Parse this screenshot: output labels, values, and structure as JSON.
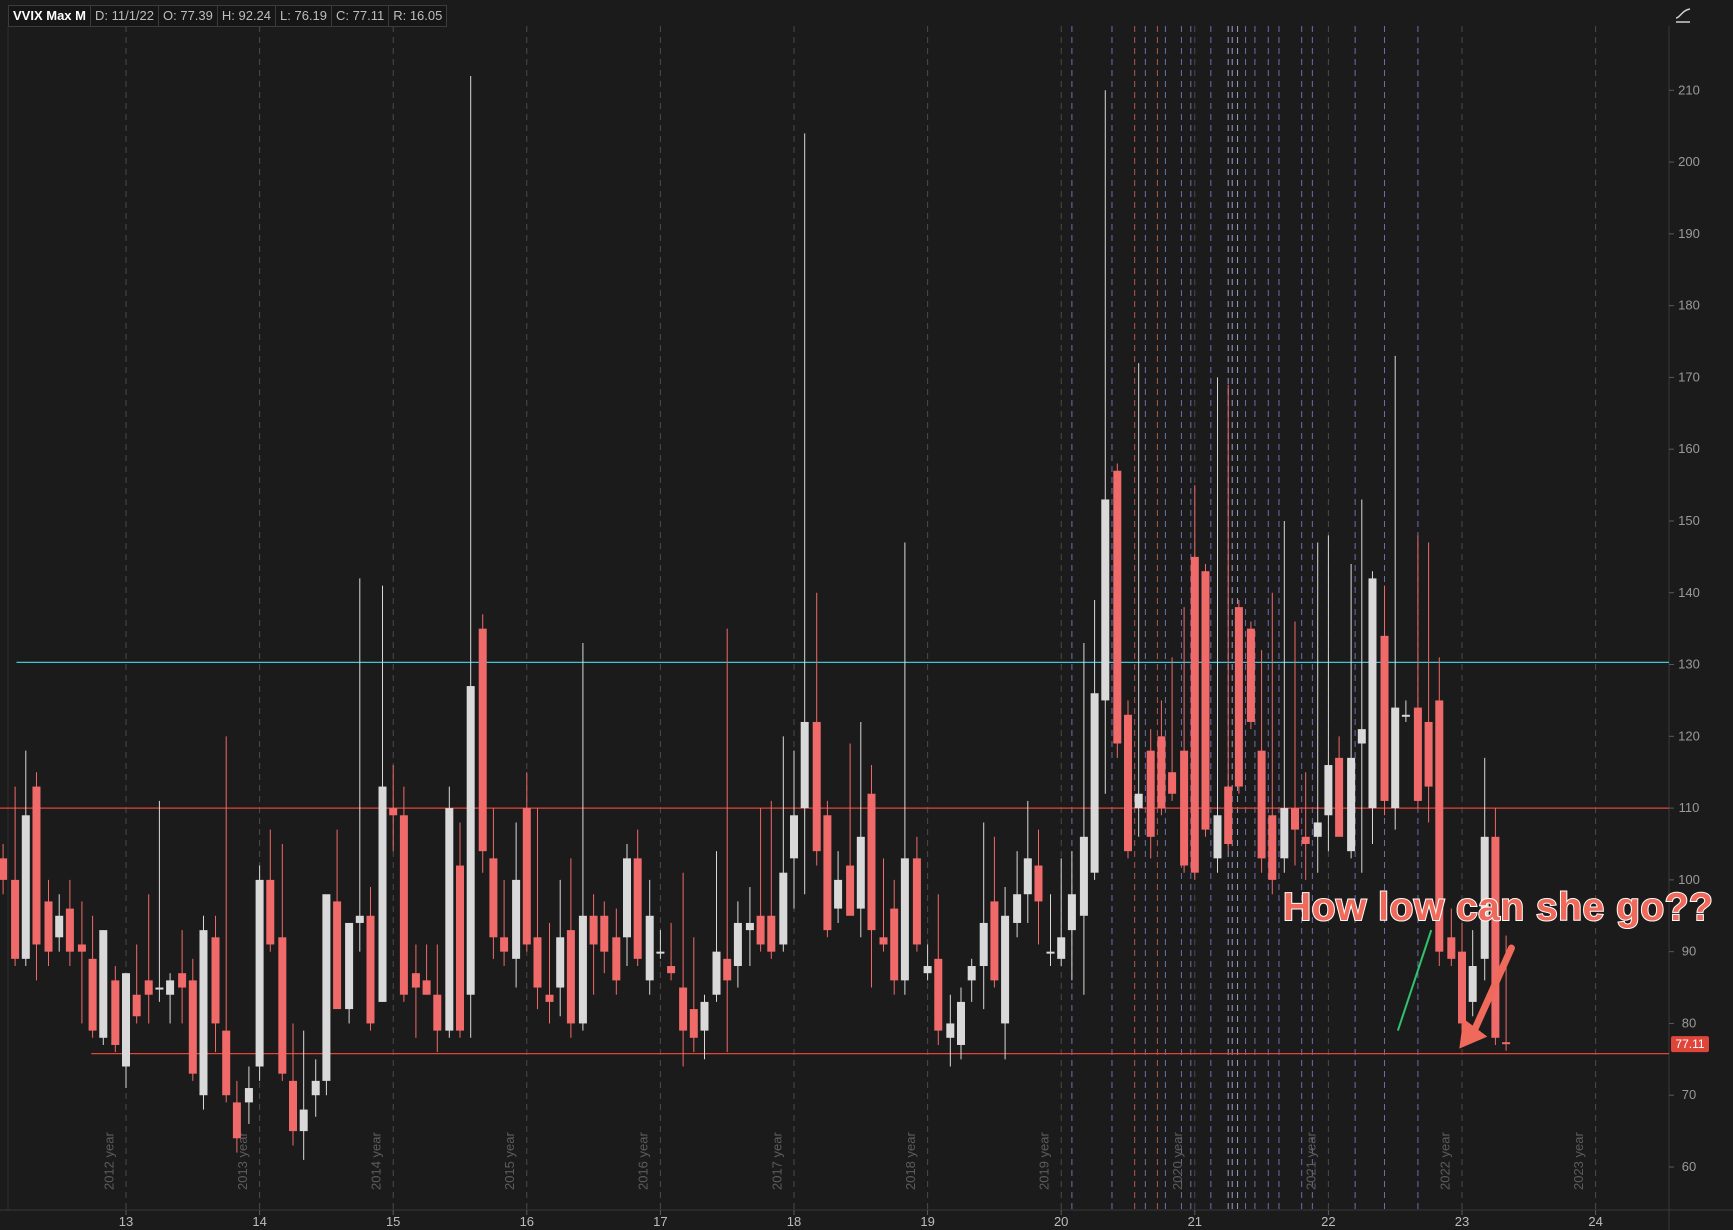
{
  "header": {
    "symbol": "VVIX Max M",
    "date": "D: 11/1/22",
    "open": "O: 77.39",
    "high": "H: 92.24",
    "low": "L: 76.19",
    "close": "C: 77.11",
    "range": "R: 16.05"
  },
  "annotation": {
    "text": "How low can she go??"
  },
  "price_tag": {
    "value": "77.11"
  },
  "icons": {
    "scale": "chart-scale-icon"
  },
  "colors": {
    "background": "#1b1b1b",
    "up_candle": "#d9d9d9",
    "down_candle": "#f06a6a",
    "cyan_level": "#3fc6d9",
    "red_level": "#e0453a",
    "trendline": "#2ec46a",
    "arrow": "#f06a5c"
  },
  "chart_data": {
    "type": "candlestick",
    "title": "VVIX Max M",
    "y_range": [
      55,
      215
    ],
    "y_ticks": [
      60,
      70,
      80,
      90,
      100,
      110,
      120,
      130,
      140,
      150,
      160,
      170,
      180,
      190,
      200,
      210
    ],
    "x_ticks": [
      {
        "label": "13",
        "t": 2013
      },
      {
        "label": "14",
        "t": 2014
      },
      {
        "label": "15",
        "t": 2015
      },
      {
        "label": "16",
        "t": 2016
      },
      {
        "label": "17",
        "t": 2017
      },
      {
        "label": "18",
        "t": 2018
      },
      {
        "label": "19",
        "t": 2019
      },
      {
        "label": "20",
        "t": 2020
      },
      {
        "label": "21",
        "t": 2021
      },
      {
        "label": "22",
        "t": 2022
      },
      {
        "label": "23",
        "t": 2023
      },
      {
        "label": "24",
        "t": 2024
      }
    ],
    "year_markers": [
      {
        "label": "2012 year",
        "t": 2012.875
      },
      {
        "label": "2013 year",
        "t": 2013.875
      },
      {
        "label": "2014 year",
        "t": 2014.875
      },
      {
        "label": "2015 year",
        "t": 2015.875
      },
      {
        "label": "2016 year",
        "t": 2016.875
      },
      {
        "label": "2017 year",
        "t": 2017.875
      },
      {
        "label": "2018 year",
        "t": 2018.875
      },
      {
        "label": "2019 year",
        "t": 2019.875
      },
      {
        "label": "2020 year",
        "t": 2020.875
      },
      {
        "label": "2021 year",
        "t": 2021.875
      },
      {
        "label": "2022 year",
        "t": 2022.875
      },
      {
        "label": "2023 year",
        "t": 2023.875
      }
    ],
    "event_lines": [
      {
        "t": 2020.08,
        "color": "#8a8ae0"
      },
      {
        "t": 2020.38,
        "color": "#8a8ae0"
      },
      {
        "t": 2020.55,
        "color": "#e06a6a"
      },
      {
        "t": 2020.63,
        "color": "#8a8ae0"
      },
      {
        "t": 2020.72,
        "color": "#e06a6a"
      },
      {
        "t": 2020.78,
        "color": "#8a8ae0"
      },
      {
        "t": 2020.9,
        "color": "#8a8ae0"
      },
      {
        "t": 2020.97,
        "color": "#8a8ae0"
      },
      {
        "t": 2021.12,
        "color": "#8a8ae0"
      },
      {
        "t": 2021.25,
        "color": "#c8c8ff"
      },
      {
        "t": 2021.28,
        "color": "#c8c8ff"
      },
      {
        "t": 2021.32,
        "color": "#c8c8ff"
      },
      {
        "t": 2021.38,
        "color": "#8a8ae0"
      },
      {
        "t": 2021.45,
        "color": "#8a8ae0"
      },
      {
        "t": 2021.55,
        "color": "#8a8ae0"
      },
      {
        "t": 2021.63,
        "color": "#8a8ae0"
      },
      {
        "t": 2021.8,
        "color": "#8a8ae0"
      },
      {
        "t": 2021.88,
        "color": "#8a8ae0"
      },
      {
        "t": 2022.2,
        "color": "#8a8ae0"
      },
      {
        "t": 2022.42,
        "color": "#8a8ae0"
      },
      {
        "t": 2022.67,
        "color": "#8a8ae0"
      }
    ],
    "horizontal_levels": [
      {
        "value": 130.3,
        "color": "#3fc6d9",
        "from": 2012.18
      },
      {
        "value": 110,
        "color": "#e0453a",
        "from": 2012.0
      },
      {
        "value": 75.8,
        "color": "#e0453a",
        "from": 2012.74
      }
    ],
    "trendline": {
      "from": [
        2022.52,
        79
      ],
      "to": [
        2022.77,
        93
      ]
    },
    "arrow": {
      "from": [
        2023.37,
        90.5
      ],
      "to": [
        2022.98,
        76.5
      ]
    },
    "candles": [
      {
        "t": 2012.08,
        "o": 103,
        "h": 105,
        "l": 98,
        "c": 100
      },
      {
        "t": 2012.17,
        "o": 100,
        "h": 113,
        "l": 88,
        "c": 89
      },
      {
        "t": 2012.25,
        "o": 89,
        "h": 118,
        "l": 88,
        "c": 109
      },
      {
        "t": 2012.33,
        "o": 113,
        "h": 115,
        "l": 86,
        "c": 91
      },
      {
        "t": 2012.42,
        "o": 97,
        "h": 100,
        "l": 88,
        "c": 90
      },
      {
        "t": 2012.5,
        "o": 92,
        "h": 98,
        "l": 90,
        "c": 95
      },
      {
        "t": 2012.58,
        "o": 96,
        "h": 100,
        "l": 88,
        "c": 90
      },
      {
        "t": 2012.67,
        "o": 91,
        "h": 97,
        "l": 80,
        "c": 90
      },
      {
        "t": 2012.75,
        "o": 89,
        "h": 95,
        "l": 78,
        "c": 79
      },
      {
        "t": 2012.83,
        "o": 78,
        "h": 93,
        "l": 77,
        "c": 93
      },
      {
        "t": 2012.92,
        "o": 86,
        "h": 88,
        "l": 76,
        "c": 77
      },
      {
        "t": 2013.0,
        "o": 74,
        "h": 87,
        "l": 71,
        "c": 87
      },
      {
        "t": 2013.08,
        "o": 84,
        "h": 91,
        "l": 80,
        "c": 81
      },
      {
        "t": 2013.17,
        "o": 86,
        "h": 98,
        "l": 80,
        "c": 84
      },
      {
        "t": 2013.25,
        "o": 85,
        "h": 111,
        "l": 83,
        "c": 85
      },
      {
        "t": 2013.33,
        "o": 84,
        "h": 87,
        "l": 80,
        "c": 86
      },
      {
        "t": 2013.42,
        "o": 87,
        "h": 93,
        "l": 80,
        "c": 85
      },
      {
        "t": 2013.5,
        "o": 86,
        "h": 89,
        "l": 72,
        "c": 73
      },
      {
        "t": 2013.58,
        "o": 70,
        "h": 95,
        "l": 68,
        "c": 93
      },
      {
        "t": 2013.67,
        "o": 92,
        "h": 95,
        "l": 76,
        "c": 80
      },
      {
        "t": 2013.75,
        "o": 79,
        "h": 120,
        "l": 69,
        "c": 70
      },
      {
        "t": 2013.83,
        "o": 69,
        "h": 72,
        "l": 62,
        "c": 64
      },
      {
        "t": 2013.92,
        "o": 69,
        "h": 74,
        "l": 66,
        "c": 71
      },
      {
        "t": 2014.0,
        "o": 74,
        "h": 102,
        "l": 72,
        "c": 100
      },
      {
        "t": 2014.08,
        "o": 100,
        "h": 107,
        "l": 90,
        "c": 91
      },
      {
        "t": 2014.17,
        "o": 92,
        "h": 105,
        "l": 72,
        "c": 73
      },
      {
        "t": 2014.25,
        "o": 72,
        "h": 80,
        "l": 63,
        "c": 65
      },
      {
        "t": 2014.33,
        "o": 65,
        "h": 79,
        "l": 61,
        "c": 68
      },
      {
        "t": 2014.42,
        "o": 70,
        "h": 75,
        "l": 67,
        "c": 72
      },
      {
        "t": 2014.5,
        "o": 72,
        "h": 84,
        "l": 70,
        "c": 98
      },
      {
        "t": 2014.58,
        "o": 97,
        "h": 107,
        "l": 88,
        "c": 82
      },
      {
        "t": 2014.67,
        "o": 82,
        "h": 94,
        "l": 80,
        "c": 94
      },
      {
        "t": 2014.75,
        "o": 94,
        "h": 142,
        "l": 90,
        "c": 95
      },
      {
        "t": 2014.83,
        "o": 95,
        "h": 99,
        "l": 79,
        "c": 80
      },
      {
        "t": 2014.92,
        "o": 83,
        "h": 141,
        "l": 83,
        "c": 113
      },
      {
        "t": 2015.0,
        "o": 110,
        "h": 116,
        "l": 104,
        "c": 109
      },
      {
        "t": 2015.08,
        "o": 109,
        "h": 113,
        "l": 83,
        "c": 84
      },
      {
        "t": 2015.17,
        "o": 87,
        "h": 91,
        "l": 78,
        "c": 85
      },
      {
        "t": 2015.25,
        "o": 86,
        "h": 91,
        "l": 84,
        "c": 84
      },
      {
        "t": 2015.33,
        "o": 84,
        "h": 91,
        "l": 76,
        "c": 79
      },
      {
        "t": 2015.42,
        "o": 79,
        "h": 113,
        "l": 78,
        "c": 110
      },
      {
        "t": 2015.5,
        "o": 102,
        "h": 108,
        "l": 78,
        "c": 79
      },
      {
        "t": 2015.58,
        "o": 84,
        "h": 212,
        "l": 78,
        "c": 127
      },
      {
        "t": 2015.67,
        "o": 135,
        "h": 137,
        "l": 101,
        "c": 104
      },
      {
        "t": 2015.75,
        "o": 103,
        "h": 110,
        "l": 89,
        "c": 92
      },
      {
        "t": 2015.83,
        "o": 92,
        "h": 100,
        "l": 88,
        "c": 90
      },
      {
        "t": 2015.92,
        "o": 89,
        "h": 108,
        "l": 85,
        "c": 100
      },
      {
        "t": 2016.0,
        "o": 110,
        "h": 115,
        "l": 90,
        "c": 91
      },
      {
        "t": 2016.08,
        "o": 92,
        "h": 110,
        "l": 82,
        "c": 85
      },
      {
        "t": 2016.17,
        "o": 84,
        "h": 94,
        "l": 80,
        "c": 83
      },
      {
        "t": 2016.25,
        "o": 85,
        "h": 100,
        "l": 81,
        "c": 92
      },
      {
        "t": 2016.33,
        "o": 93,
        "h": 103,
        "l": 78,
        "c": 80
      },
      {
        "t": 2016.42,
        "o": 80,
        "h": 133,
        "l": 79,
        "c": 95
      },
      {
        "t": 2016.5,
        "o": 95,
        "h": 98,
        "l": 84,
        "c": 91
      },
      {
        "t": 2016.58,
        "o": 95,
        "h": 97,
        "l": 87,
        "c": 90
      },
      {
        "t": 2016.67,
        "o": 92,
        "h": 96,
        "l": 84,
        "c": 86
      },
      {
        "t": 2016.75,
        "o": 92,
        "h": 105,
        "l": 88,
        "c": 103
      },
      {
        "t": 2016.83,
        "o": 103,
        "h": 107,
        "l": 88,
        "c": 89
      },
      {
        "t": 2016.92,
        "o": 86,
        "h": 100,
        "l": 84,
        "c": 95
      },
      {
        "t": 2017.0,
        "o": 90,
        "h": 93,
        "l": 89,
        "c": 90
      },
      {
        "t": 2017.08,
        "o": 88,
        "h": 94,
        "l": 86,
        "c": 87
      },
      {
        "t": 2017.17,
        "o": 85,
        "h": 101,
        "l": 74,
        "c": 79
      },
      {
        "t": 2017.25,
        "o": 82,
        "h": 92,
        "l": 76,
        "c": 78
      },
      {
        "t": 2017.33,
        "o": 79,
        "h": 84,
        "l": 75,
        "c": 83
      },
      {
        "t": 2017.42,
        "o": 84,
        "h": 104,
        "l": 83,
        "c": 90
      },
      {
        "t": 2017.5,
        "o": 89,
        "h": 135,
        "l": 76,
        "c": 86
      },
      {
        "t": 2017.58,
        "o": 88,
        "h": 97,
        "l": 85,
        "c": 94
      },
      {
        "t": 2017.67,
        "o": 93,
        "h": 99,
        "l": 88,
        "c": 94
      },
      {
        "t": 2017.75,
        "o": 95,
        "h": 110,
        "l": 90,
        "c": 91
      },
      {
        "t": 2017.83,
        "o": 95,
        "h": 111,
        "l": 89,
        "c": 90
      },
      {
        "t": 2017.92,
        "o": 91,
        "h": 120,
        "l": 90,
        "c": 101
      },
      {
        "t": 2018.0,
        "o": 103,
        "h": 118,
        "l": 96,
        "c": 109
      },
      {
        "t": 2018.08,
        "o": 110,
        "h": 204,
        "l": 98,
        "c": 122
      },
      {
        "t": 2018.17,
        "o": 122,
        "h": 140,
        "l": 102,
        "c": 104
      },
      {
        "t": 2018.25,
        "o": 109,
        "h": 111,
        "l": 92,
        "c": 93
      },
      {
        "t": 2018.33,
        "o": 96,
        "h": 104,
        "l": 94,
        "c": 100
      },
      {
        "t": 2018.42,
        "o": 102,
        "h": 119,
        "l": 96,
        "c": 95
      },
      {
        "t": 2018.5,
        "o": 96,
        "h": 122,
        "l": 92,
        "c": 106
      },
      {
        "t": 2018.58,
        "o": 112,
        "h": 116,
        "l": 85,
        "c": 93
      },
      {
        "t": 2018.67,
        "o": 92,
        "h": 103,
        "l": 90,
        "c": 91
      },
      {
        "t": 2018.75,
        "o": 96,
        "h": 100,
        "l": 84,
        "c": 86
      },
      {
        "t": 2018.83,
        "o": 86,
        "h": 147,
        "l": 84,
        "c": 103
      },
      {
        "t": 2018.92,
        "o": 103,
        "h": 106,
        "l": 90,
        "c": 91
      },
      {
        "t": 2019.0,
        "o": 87,
        "h": 91,
        "l": 86,
        "c": 88
      },
      {
        "t": 2019.08,
        "o": 89,
        "h": 98,
        "l": 77,
        "c": 79
      },
      {
        "t": 2019.17,
        "o": 78,
        "h": 84,
        "l": 74,
        "c": 80
      },
      {
        "t": 2019.25,
        "o": 77,
        "h": 85,
        "l": 75,
        "c": 83
      },
      {
        "t": 2019.33,
        "o": 86,
        "h": 89,
        "l": 83,
        "c": 88
      },
      {
        "t": 2019.42,
        "o": 88,
        "h": 108,
        "l": 82,
        "c": 94
      },
      {
        "t": 2019.5,
        "o": 97,
        "h": 106,
        "l": 85,
        "c": 86
      },
      {
        "t": 2019.58,
        "o": 80,
        "h": 99,
        "l": 75,
        "c": 95
      },
      {
        "t": 2019.67,
        "o": 94,
        "h": 104,
        "l": 92,
        "c": 98
      },
      {
        "t": 2019.75,
        "o": 98,
        "h": 111,
        "l": 94,
        "c": 103
      },
      {
        "t": 2019.83,
        "o": 102,
        "h": 107,
        "l": 91,
        "c": 97
      },
      {
        "t": 2019.92,
        "o": 90,
        "h": 98,
        "l": 88,
        "c": 90
      },
      {
        "t": 2020.0,
        "o": 89,
        "h": 103,
        "l": 88,
        "c": 92
      },
      {
        "t": 2020.08,
        "o": 93,
        "h": 104,
        "l": 86,
        "c": 98
      },
      {
        "t": 2020.17,
        "o": 95,
        "h": 133,
        "l": 84,
        "c": 106
      },
      {
        "t": 2020.25,
        "o": 101,
        "h": 139,
        "l": 100,
        "c": 126
      },
      {
        "t": 2020.33,
        "o": 125,
        "h": 210,
        "l": 112,
        "c": 153
      },
      {
        "t": 2020.42,
        "o": 157,
        "h": 158,
        "l": 117,
        "c": 119
      },
      {
        "t": 2020.5,
        "o": 123,
        "h": 125,
        "l": 103,
        "c": 104
      },
      {
        "t": 2020.58,
        "o": 110,
        "h": 172,
        "l": 106,
        "c": 112
      },
      {
        "t": 2020.67,
        "o": 118,
        "h": 121,
        "l": 103,
        "c": 106
      },
      {
        "t": 2020.75,
        "o": 120,
        "h": 125,
        "l": 109,
        "c": 110
      },
      {
        "t": 2020.83,
        "o": 115,
        "h": 131,
        "l": 111,
        "c": 112
      },
      {
        "t": 2020.92,
        "o": 118,
        "h": 138,
        "l": 101,
        "c": 102
      },
      {
        "t": 2021.0,
        "o": 145,
        "h": 155,
        "l": 100,
        "c": 101
      },
      {
        "t": 2021.08,
        "o": 143,
        "h": 144,
        "l": 106,
        "c": 107
      },
      {
        "t": 2021.17,
        "o": 103,
        "h": 170,
        "l": 101,
        "c": 109
      },
      {
        "t": 2021.25,
        "o": 113,
        "h": 169,
        "l": 104,
        "c": 105
      },
      {
        "t": 2021.33,
        "o": 138,
        "h": 139,
        "l": 112,
        "c": 113
      },
      {
        "t": 2021.42,
        "o": 135,
        "h": 136,
        "l": 121,
        "c": 122
      },
      {
        "t": 2021.5,
        "o": 118,
        "h": 132,
        "l": 101,
        "c": 103
      },
      {
        "t": 2021.58,
        "o": 109,
        "h": 140,
        "l": 98,
        "c": 100
      },
      {
        "t": 2021.67,
        "o": 103,
        "h": 150,
        "l": 101,
        "c": 110
      },
      {
        "t": 2021.75,
        "o": 110,
        "h": 136,
        "l": 102,
        "c": 107
      },
      {
        "t": 2021.83,
        "o": 106,
        "h": 115,
        "l": 100,
        "c": 105
      },
      {
        "t": 2021.92,
        "o": 106,
        "h": 147,
        "l": 101,
        "c": 108
      },
      {
        "t": 2022.0,
        "o": 109,
        "h": 148,
        "l": 104,
        "c": 116
      },
      {
        "t": 2022.08,
        "o": 117,
        "h": 120,
        "l": 110,
        "c": 106
      },
      {
        "t": 2022.17,
        "o": 104,
        "h": 144,
        "l": 103,
        "c": 117
      },
      {
        "t": 2022.25,
        "o": 119,
        "h": 153,
        "l": 101,
        "c": 121
      },
      {
        "t": 2022.33,
        "o": 110,
        "h": 143,
        "l": 105,
        "c": 142
      },
      {
        "t": 2022.42,
        "o": 134,
        "h": 141,
        "l": 109,
        "c": 111
      },
      {
        "t": 2022.5,
        "o": 110,
        "h": 173,
        "l": 107,
        "c": 124
      },
      {
        "t": 2022.58,
        "o": 123,
        "h": 125,
        "l": 122,
        "c": 123
      },
      {
        "t": 2022.67,
        "o": 124,
        "h": 148,
        "l": 110,
        "c": 111
      },
      {
        "t": 2022.75,
        "o": 122,
        "h": 147,
        "l": 108,
        "c": 113
      },
      {
        "t": 2022.83,
        "o": 125,
        "h": 131,
        "l": 88,
        "c": 90
      },
      {
        "t": 2022.92,
        "o": 92,
        "h": 96,
        "l": 88,
        "c": 89
      },
      {
        "t": 2023.0,
        "o": 90,
        "h": 94,
        "l": 79,
        "c": 80
      },
      {
        "t": 2023.08,
        "o": 83,
        "h": 93,
        "l": 81,
        "c": 88
      },
      {
        "t": 2023.17,
        "o": 89,
        "h": 117,
        "l": 86,
        "c": 106
      },
      {
        "t": 2023.25,
        "o": 106,
        "h": 110,
        "l": 77,
        "c": 78
      },
      {
        "t": 2023.33,
        "o": 77.39,
        "h": 92.24,
        "l": 76.19,
        "c": 77.11
      }
    ]
  }
}
